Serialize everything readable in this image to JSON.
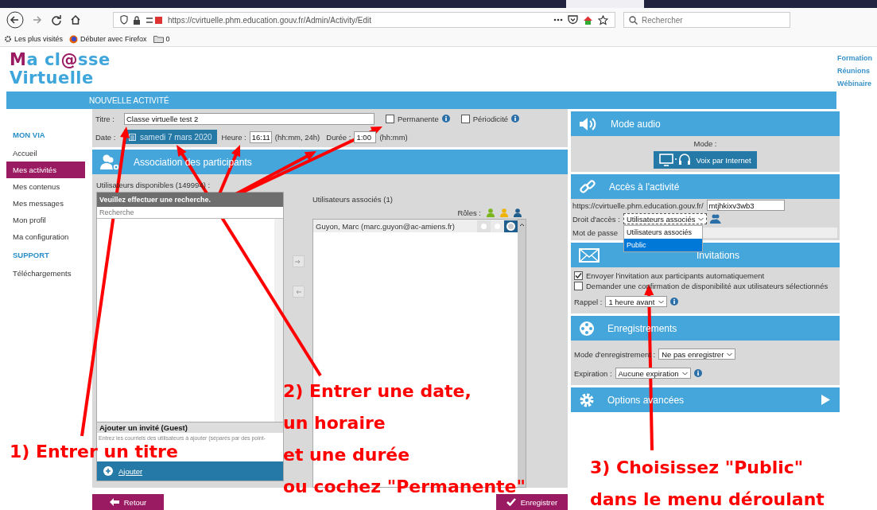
{
  "browser": {
    "url": "https://cvirtuelle.phm.education.gouv.fr/Admin/Activity/Edit",
    "search_placeholder": "Rechercher",
    "bookmarks": [
      "Les plus visités",
      "Débuter avec Firefox",
      "0"
    ]
  },
  "header": {
    "logo_line_1": [
      {
        "text": "M",
        "accent": true
      },
      {
        "text": "a cl",
        "accent": false
      },
      {
        "text": "@",
        "accent": true
      },
      {
        "text": "sse",
        "accent": false
      }
    ],
    "logo_line_2": "Virtuelle",
    "links": [
      "Formation",
      "Réunions",
      "Wébinaire"
    ]
  },
  "page_title": "NOUVELLE ACTIVITÉ",
  "sidebar": [
    {
      "heading": "MON VIA",
      "items": [
        {
          "label": "Accueil",
          "selected": false
        },
        {
          "label": "Mes activités",
          "selected": true
        },
        {
          "label": "Mes contenus",
          "selected": false
        },
        {
          "label": "Mes messages",
          "selected": false
        },
        {
          "label": "Mon profil",
          "selected": false
        },
        {
          "label": "Ma configuration",
          "selected": false
        }
      ]
    },
    {
      "heading": "SUPPORT",
      "items": [
        {
          "label": "Téléchargements",
          "selected": false
        }
      ]
    }
  ],
  "form": {
    "title_label": "Titre :",
    "title_value": "Classe virtuelle test 2",
    "options": [
      {
        "label": "Permanente",
        "checked": false
      },
      {
        "label": "Périodicité",
        "checked": false
      }
    ],
    "date_label": "Date :",
    "date_value": "samedi 7 mars 2020",
    "time_label": "Heure :",
    "time_value": "16:11",
    "time_hint": "(hh:mm, 24h)",
    "duration_label": "Durée :",
    "duration_value": "1:00",
    "duration_hint": "(hh:mm)"
  },
  "participants": {
    "title": "Association des participants",
    "available_label": "Utilisateurs disponibles (149994) :",
    "search_message": "Veuillez effectuer une recherche.",
    "search_placeholder": "Recherche",
    "guest_title": "Ajouter un invité (Guest)",
    "guest_placeholder": "Entrez les courriels des utilisateurs à ajouter (séparés par des point-",
    "add_button": "Ajouter",
    "associated_label": "Utilisateurs associés (1)",
    "roles_label": "Rôles :",
    "roles": [
      {
        "color": "#7ab51d"
      },
      {
        "color": "#f0b400"
      },
      {
        "color": "#1f5e8c"
      }
    ],
    "users": [
      {
        "name": "Guyon, Marc (marc.guyon@ac-amiens.fr)",
        "roles": [
          {
            "selected": false
          },
          {
            "selected": false
          },
          {
            "selected": true
          }
        ]
      }
    ]
  },
  "audio": {
    "title": "Mode audio",
    "mode_label": "Mode :",
    "mode_button": "Voix par Internet"
  },
  "access": {
    "title": "Accès à l'activité",
    "url_prefix": "https://cvirtuelle.phm.education.gouv.fr/",
    "url_value": "mtjhkixv3wb3",
    "rights_label": "Droit d'accès :",
    "rights_value": "Utilisateurs associés",
    "rights_options": [
      {
        "label": "Utilisateurs associés",
        "selected": false
      },
      {
        "label": "Public",
        "selected": true
      }
    ],
    "password_label": "Mot de passe"
  },
  "invitations": {
    "title": "Invitations",
    "options": [
      {
        "label": "Envoyer l'invitation aux participants automatiquement",
        "checked": true
      },
      {
        "label": "Demander une confirmation de disponibilité aux utilisateurs sélectionnés",
        "checked": false
      }
    ],
    "reminder_label": "Rappel :",
    "reminder_value": "1 heure avant"
  },
  "recordings": {
    "title": "Enregistrements",
    "mode_label": "Mode d'enregistrement :",
    "mode_value": "Ne pas enregistrer",
    "expiration_label": "Expiration :",
    "expiration_value": "Aucune expiration"
  },
  "advanced": {
    "title": "Options avancées"
  },
  "buttons": {
    "back": "Retour",
    "save": "Enregistrer"
  },
  "annotations": [
    {
      "lines": [
        "1) Entrer un titre"
      ]
    },
    {
      "lines": [
        "2) Entrer une date,",
        "un horaire",
        "et une durée",
        "ou cochez \"Permanente\""
      ]
    },
    {
      "lines": [
        "3) Choisissez \"Public\"",
        "dans le menu déroulant"
      ]
    }
  ]
}
